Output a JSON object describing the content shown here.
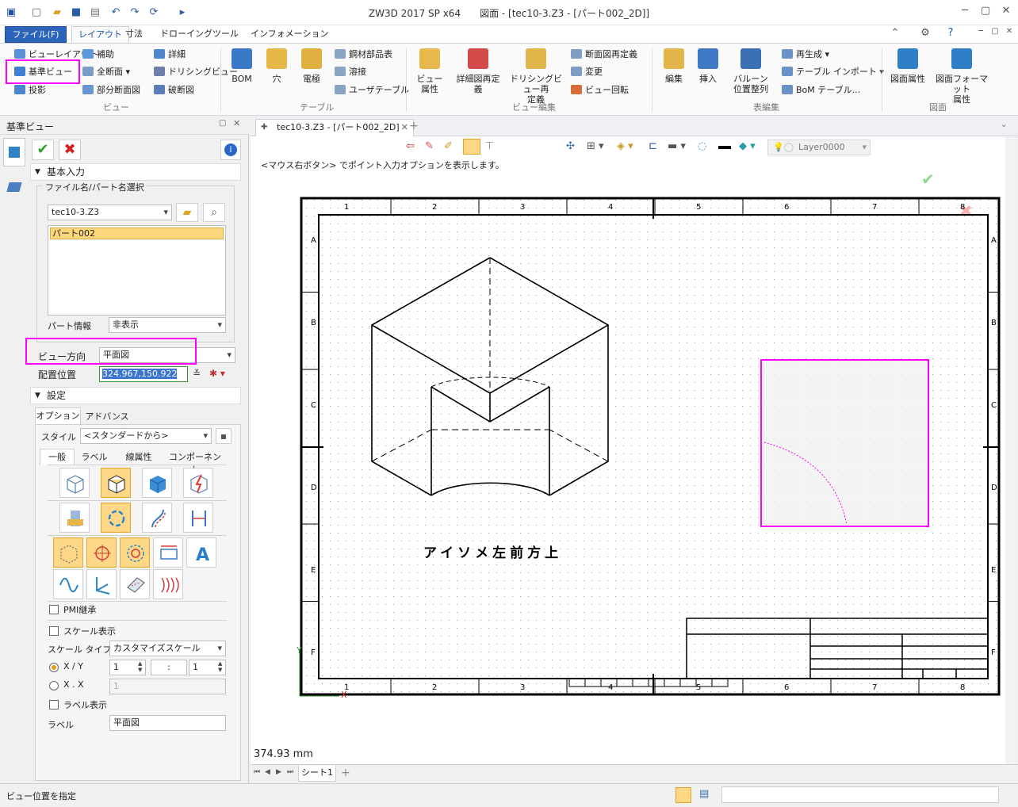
{
  "app": {
    "title": "ZW3D 2017 SP x64　　図面 - [tec10-3.Z3 - [パート002_2D]]"
  },
  "ribbon_tabs": [
    "ファイル(F)",
    "レイアウト",
    "寸法",
    "ドローイング",
    "ツール",
    "インフォメーション"
  ],
  "ribbon": {
    "view_group": {
      "label": "ビュー",
      "items": [
        "ビューレイアウト",
        "基準ビュー",
        "投影",
        "補助",
        "全断面",
        "部分断面図",
        "詳細",
        "ドリシングビュー",
        "破断図"
      ]
    },
    "table_group": {
      "label": "テーブル",
      "big": [
        "BOM",
        "穴",
        "電極"
      ],
      "items": [
        "鋼材部品表",
        "溶接",
        "ユーザテーブル"
      ]
    },
    "view_edit_group": {
      "label": "ビュー編集",
      "big": [
        "ビュー\n属性",
        "詳細図再定\n義",
        "ドリシングビュー再\n定義"
      ],
      "items": [
        "断面図再定義",
        "変更",
        "ビュー回転"
      ]
    },
    "table_edit_group": {
      "label": "表編集",
      "big": [
        "編集",
        "挿入",
        "バルーン\n位置整列"
      ],
      "items": [
        "再生成",
        "テーブル インポート",
        "BoM テーブル..."
      ]
    },
    "drawing_group": {
      "label": "図面",
      "big": [
        "図面属性",
        "図面フォーマット\n属性"
      ]
    }
  },
  "left_panel": {
    "title": "基準ビュー",
    "section_basic": "基本入力",
    "file_group_label": "ファイル名/パート名選択",
    "file_value": "tec10-3.Z3",
    "part_list": [
      "パート002"
    ],
    "part_info_label": "パート情報",
    "part_info_value": "非表示",
    "view_dir_label": "ビュー方向",
    "view_dir_value": "平面図",
    "placement_label": "配置位置",
    "placement_value": "324.967,150.922",
    "section_settings": "設定",
    "tabs": [
      "オプション",
      "アドバンス"
    ],
    "style_label": "スタイル",
    "style_value": "<スタンダードから>",
    "subtabs": [
      "一般",
      "ラベル",
      "線属性",
      "コンポーネント"
    ],
    "pmi_label": "PMI継承",
    "scale_show_label": "スケール表示",
    "scale_type_label": "スケール タイプ",
    "scale_type_value": "カスタマイズスケール",
    "xy_label": "X / Y",
    "xx_label": "X . X",
    "xy_num": "1",
    "xy_den": "1",
    "xx_val": "1",
    "colon": ":",
    "label_show_label": "ラベル表示",
    "label_label": "ラベル",
    "label_value": "平面図"
  },
  "doc": {
    "tab_label": "tec10-3.Z3 - [パート002_2D]",
    "hint": "<マウス右ボタン> でポイント入力オプションを表示します。",
    "layer": "Layer0000",
    "view_caption": "アイソメ左前方上",
    "col_labels": [
      "1",
      "2",
      "3",
      "4",
      "5",
      "6",
      "7",
      "8"
    ],
    "row_labels": [
      "A",
      "B",
      "C",
      "D",
      "E",
      "F"
    ],
    "measure": "374.93 mm",
    "axis_x": "X",
    "axis_y": "Y"
  },
  "sheet": {
    "tab": "シート1"
  },
  "status": {
    "text": "ビュー位置を指定"
  }
}
